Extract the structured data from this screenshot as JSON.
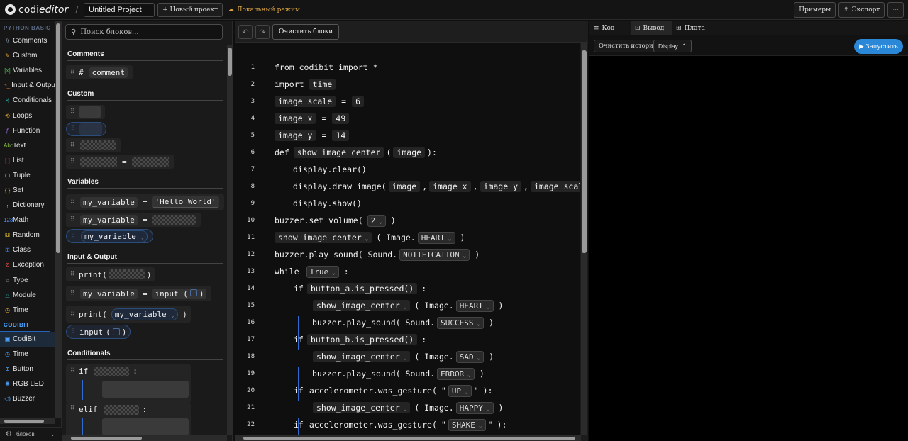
{
  "topbar": {
    "brand_mark": "codi",
    "brand_rest": "editor",
    "project_name": "Untitled Project",
    "new_project": "+ Новый проект",
    "local_mode": "Локальный режим",
    "examples": "Примеры",
    "export": "Экспорт",
    "more": "···"
  },
  "categories": {
    "python_header": "PYTHON BASIC",
    "python_items": [
      {
        "icon": "//",
        "label": "Comments",
        "color": "#9aa7b8"
      },
      {
        "icon": "✎",
        "label": "Custom",
        "color": "#e0a030"
      },
      {
        "icon": "[x]",
        "label": "Variables",
        "color": "#4caf50"
      },
      {
        "icon": ">_",
        "label": "Input & Output",
        "color": "#e07030"
      },
      {
        "icon": "⊰",
        "label": "Conditionals",
        "color": "#26a69a"
      },
      {
        "icon": "⟲",
        "label": "Loops",
        "color": "#f0b030"
      },
      {
        "icon": "ƒ",
        "label": "Function",
        "color": "#9c6ade"
      },
      {
        "icon": "Abc",
        "label": "Text",
        "color": "#8bc34a"
      },
      {
        "icon": "[ ]",
        "label": "List",
        "color": "#e04848"
      },
      {
        "icon": "( )",
        "label": "Tuple",
        "color": "#e07030"
      },
      {
        "icon": "{ }",
        "label": "Set",
        "color": "#e0a030"
      },
      {
        "icon": "⋮",
        "label": "Dictionary",
        "color": "#aaaaaa"
      },
      {
        "icon": "123",
        "label": "Math",
        "color": "#4c8df6"
      },
      {
        "icon": "⚅",
        "label": "Random",
        "color": "#e0c030"
      },
      {
        "icon": "⊞",
        "label": "Class",
        "color": "#4c8df6"
      },
      {
        "icon": "⊘",
        "label": "Exception",
        "color": "#e04848"
      },
      {
        "icon": "⌂",
        "label": "Type",
        "color": "#aaaaaa"
      },
      {
        "icon": "△",
        "label": "Module",
        "color": "#26a69a"
      },
      {
        "icon": "◷",
        "label": "Time",
        "color": "#f0b030"
      }
    ],
    "codibit_header": "CODIBIT",
    "codibit_items": [
      {
        "icon": "▣",
        "label": "CodiBit",
        "color": "#4da3ff"
      },
      {
        "icon": "◷",
        "label": "Time",
        "color": "#4da3ff"
      },
      {
        "icon": "⊕",
        "label": "Button",
        "color": "#4da3ff"
      },
      {
        "icon": "✺",
        "label": "RGB LED",
        "color": "#4da3ff"
      },
      {
        "icon": "◁)",
        "label": "Buzzer",
        "color": "#4da3ff"
      }
    ],
    "bottom_label": "блоков"
  },
  "palette": {
    "search_placeholder": "Поиск блоков...",
    "sections": {
      "comments": "Comments",
      "custom": "Custom",
      "variables": "Variables",
      "io": "Input & Output",
      "conditionals": "Conditionals"
    },
    "comment_hash": "#",
    "comment_word": "comment",
    "var_name": "my_variable",
    "equals": "=",
    "hello": "'Hello World'",
    "print_open": "print(",
    "close_paren": ")",
    "input_word": "input",
    "open_paren": "(",
    "if_word": "if",
    "elif_word": "elif",
    "colon": ":"
  },
  "editor": {
    "undo": "↶",
    "redo": "↷",
    "clear_blocks": "Очистить блоки",
    "line_numbers": [
      "1",
      "2",
      "3",
      "4",
      "5",
      "6",
      "7",
      "8",
      "9",
      "10",
      "11",
      "12",
      "13",
      "14",
      "15",
      "16",
      "17",
      "18",
      "19",
      "20",
      "21",
      "22"
    ],
    "lines": {
      "l1": "from codibit import *",
      "l2a": "import",
      "l2b": "time",
      "l3a": "image_scale",
      "l3b": "=",
      "l3c": "6",
      "l4a": "image_x",
      "l4b": "=",
      "l4c": "49",
      "l5a": "image_y",
      "l5b": "=",
      "l5c": "14",
      "l6a": "def",
      "l6b": "show_image_center",
      "l6c": "(",
      "l6d": "image",
      "l6e": "):",
      "l7": "display.clear()",
      "l8a": "display.draw_image(",
      "l8b": "image",
      "l8c": ",",
      "l8d": "image_x",
      "l8e": ",",
      "l8f": "image_y",
      "l8g": ",",
      "l8h": "image_scale",
      "l8i": ")",
      "l9": "display.show()",
      "l10a": "buzzer.set_volume(",
      "l10b": "2",
      "l10c": ")",
      "l11a": "show_image_center",
      "l11b": "( Image.",
      "l11c": "HEART",
      "l11d": ")",
      "l12a": "buzzer.play_sound( Sound.",
      "l12b": "NOTIFICATION",
      "l12c": ")",
      "l13a": "while",
      "l13b": "True",
      "l13c": ":",
      "l14a": "if",
      "l14b": "button_a.is_pressed()",
      "l14c": ":",
      "l15a": "show_image_center",
      "l15b": "( Image.",
      "l15c": "HEART",
      "l15d": ")",
      "l16a": "buzzer.play_sound( Sound.",
      "l16b": "SUCCESS",
      "l16c": ")",
      "l17a": "if",
      "l17b": "button_b.is_pressed()",
      "l17c": ":",
      "l18a": "show_image_center",
      "l18b": "( Image.",
      "l18c": "SAD",
      "l18d": ")",
      "l19a": "buzzer.play_sound( Sound.",
      "l19b": "ERROR",
      "l19c": ")",
      "l20a": "if",
      "l20b": "accelerometer.was_gesture(",
      "l20c": "\"",
      "l20d": "UP",
      "l20e": "\"",
      "l20f": "):",
      "l21a": "show_image_center",
      "l21b": "( Image.",
      "l21c": "HAPPY",
      "l21d": ")",
      "l22a": "if",
      "l22b": "accelerometer.was_gesture(",
      "l22c": "\"",
      "l22d": "SHAKE",
      "l22e": "\"",
      "l22f": "):"
    }
  },
  "right": {
    "tabs": [
      {
        "icon": "≡",
        "label": "Код"
      },
      {
        "icon": "⊡",
        "label": "Вывод"
      },
      {
        "icon": "⊞",
        "label": "Плата"
      }
    ],
    "clear_history": "Очистить историю",
    "display_select": "Display",
    "run": "▶ Запустить"
  }
}
